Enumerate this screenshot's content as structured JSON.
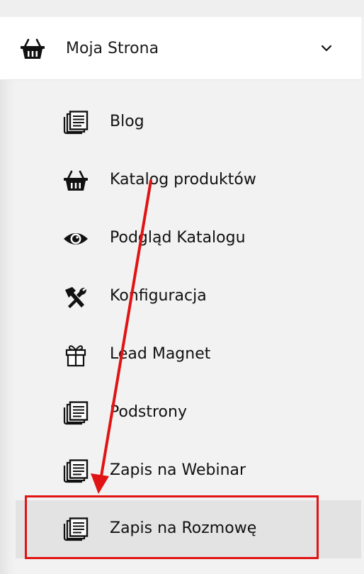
{
  "header": {
    "title": "Moja Strona",
    "icon": "basket-icon",
    "toggle_icon": "chevron-down-icon"
  },
  "menu": {
    "items": [
      {
        "label": "Blog",
        "icon": "pages-icon"
      },
      {
        "label": "Katalog produktów",
        "icon": "basket-icon"
      },
      {
        "label": "Podgląd Katalogu",
        "icon": "eye-icon"
      },
      {
        "label": " Konfiguracja",
        "icon": "tools-icon"
      },
      {
        "label": "Lead Magnet",
        "icon": "gift-icon"
      },
      {
        "label": "Podstrony",
        "icon": "pages-icon"
      },
      {
        "label": "Zapis na Webinar",
        "icon": "pages-icon"
      },
      {
        "label": "Zapis na Rozmowę",
        "icon": "pages-icon",
        "selected": true
      }
    ]
  },
  "annotation": {
    "color": "#e01414"
  }
}
